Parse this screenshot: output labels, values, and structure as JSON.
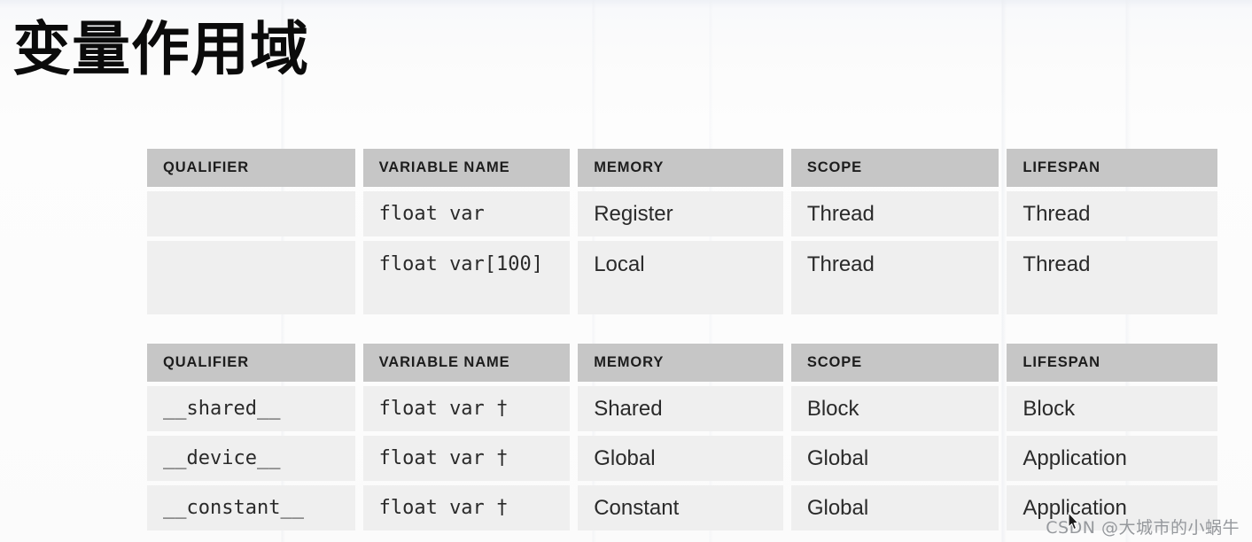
{
  "slide": {
    "title": "变量作用域",
    "background_color": "#fbfbfb",
    "header_color": "#c6c6c6",
    "cell_color": "#efefef"
  },
  "tables": [
    {
      "name": "automatic-variables",
      "columns": [
        "QUALIFIER",
        "VARIABLE NAME",
        "MEMORY",
        "SCOPE",
        "LIFESPAN"
      ],
      "rows": [
        {
          "qualifier": "",
          "variable_name": "float var",
          "memory": "Register",
          "scope": "Thread",
          "lifespan": "Thread"
        },
        {
          "qualifier": "",
          "variable_name": "float var[100]",
          "memory": "Local",
          "scope": "Thread",
          "lifespan": "Thread"
        }
      ]
    },
    {
      "name": "qualified-variables",
      "columns": [
        "QUALIFIER",
        "VARIABLE NAME",
        "MEMORY",
        "SCOPE",
        "LIFESPAN"
      ],
      "rows": [
        {
          "qualifier": "__shared__",
          "variable_name": "float var †",
          "memory": "Shared",
          "scope": "Block",
          "lifespan": "Block"
        },
        {
          "qualifier": "__device__",
          "variable_name": "float var †",
          "memory": "Global",
          "scope": "Global",
          "lifespan": "Application"
        },
        {
          "qualifier": "__constant__",
          "variable_name": "float var †",
          "memory": "Constant",
          "scope": "Global",
          "lifespan": "Application"
        }
      ]
    }
  ],
  "watermark": {
    "text": "CSDN @大城市的小蜗牛"
  }
}
